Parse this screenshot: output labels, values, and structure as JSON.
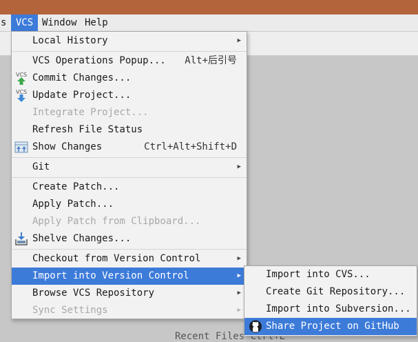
{
  "menubar": {
    "items": [
      {
        "label": "s"
      },
      {
        "label": "VCS"
      },
      {
        "label": "Window"
      },
      {
        "label": "Help"
      }
    ]
  },
  "vcs_menu": {
    "items": [
      {
        "label": "Local History"
      },
      {
        "label": "VCS Operations Popup...",
        "shortcut": "Alt+后引号"
      },
      {
        "label": "Commit Changes..."
      },
      {
        "label": "Update Project..."
      },
      {
        "label": "Integrate Project..."
      },
      {
        "label": "Refresh File Status"
      },
      {
        "label": "Show Changes",
        "shortcut": "Ctrl+Alt+Shift+D"
      },
      {
        "label": "Git"
      },
      {
        "label": "Create Patch..."
      },
      {
        "label": "Apply Patch..."
      },
      {
        "label": "Apply Patch from Clipboard..."
      },
      {
        "label": "Shelve Changes..."
      },
      {
        "label": "Checkout from Version Control"
      },
      {
        "label": "Import into Version Control"
      },
      {
        "label": "Browse VCS Repository"
      },
      {
        "label": "Sync Settings"
      }
    ]
  },
  "import_submenu": {
    "items": [
      {
        "label": "Import into CVS..."
      },
      {
        "label": "Create Git Repository..."
      },
      {
        "label": "Import into Subversion..."
      },
      {
        "label": "Share Project on GitHub"
      }
    ]
  },
  "background": {
    "partial_text": "Recent Files Ctrl+E"
  },
  "colors": {
    "title_bar": "#b3643a",
    "highlight": "#3d7bd9",
    "menu_bg": "#f2f2f2",
    "disabled_text": "#a8a8a8"
  }
}
